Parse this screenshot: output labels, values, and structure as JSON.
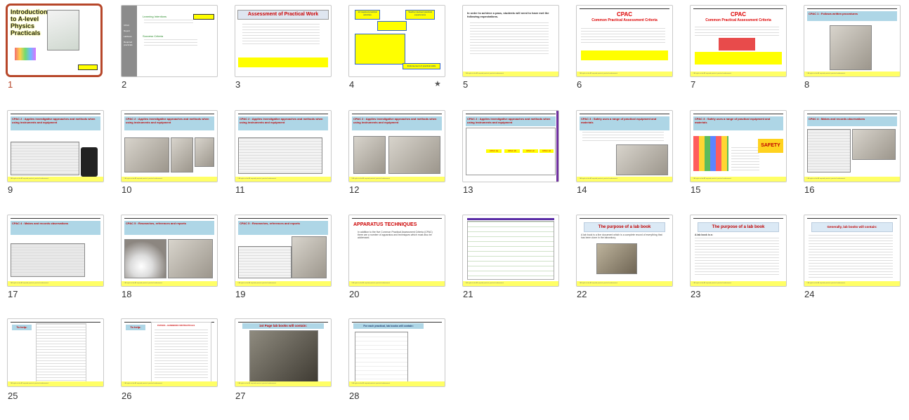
{
  "slides": [
    {
      "number": "1",
      "selected": true,
      "title": "Introduction to A-level Physics Practicals"
    },
    {
      "number": "2",
      "heading1": "Learning Intentions",
      "heading2": "Success Criteria",
      "side_items": [
        "CPAC",
        "Report",
        "Labbook",
        "Required practicals"
      ]
    },
    {
      "number": "3",
      "title": "Assessment of Practical Work"
    },
    {
      "number": "4",
      "star": "★",
      "box1": "12 required practical activities",
      "box2": "Teacher devised practical experiences",
      "bar": "Endorsement of practical skills"
    },
    {
      "number": "5",
      "title": "In order to achieve a pass, students will need to have met the following expectations."
    },
    {
      "number": "6",
      "title_big": "CPAC",
      "title_sub": "Common Practical Assessment Criteria"
    },
    {
      "number": "7",
      "title_big": "CPAC",
      "title_sub": "Common Practical Assessment Criteria"
    },
    {
      "number": "8",
      "header": "CPAC 1 : Follows written procedures"
    },
    {
      "number": "9",
      "header": "CPAC 2 : Applies investigative approaches and methods when using instruments and equipment"
    },
    {
      "number": "10",
      "header": "CPAC 2 : Applies investigative approaches and methods when using instruments and equipment"
    },
    {
      "number": "11",
      "header": "CPAC 2 : Applies investigative approaches and methods when using instruments and equipment"
    },
    {
      "number": "12",
      "header": "CPAC 2 : Applies investigative approaches and methods when using instruments and equipment"
    },
    {
      "number": "13",
      "header": "CPAC 2 : Applies investigative approaches and methods when using instruments and equipment",
      "cols": [
        "CPAC 2a",
        "CPAC 2b",
        "CPAC 2c",
        "CPAC 2d"
      ]
    },
    {
      "number": "14",
      "header": "CPAC 3 : Safely uses a range of practical equipment and materials"
    },
    {
      "number": "15",
      "header": "CPAC 3 : Safely uses a range of practical equipment and materials",
      "safety": "SAFETY"
    },
    {
      "number": "16",
      "header": "CPAC 4 : Makes and records observations"
    },
    {
      "number": "17",
      "header": "CPAC 4 : Makes and records observations"
    },
    {
      "number": "18",
      "header": "CPAC 5 : Researches, references and reports"
    },
    {
      "number": "19",
      "header": "CPAC 5 : Researches, references and reports"
    },
    {
      "number": "20",
      "title": "APPARATUS TECHNIQUES",
      "body": "In addition to the five Common Practical Assessment Criteria (CPAC) there are a number of apparatus and techniques which must also be addressed."
    },
    {
      "number": "21"
    },
    {
      "number": "22",
      "title": "The purpose of a lab book",
      "body": "A lab book is a live document which is a complete record of everything that has been done in the laboratory."
    },
    {
      "number": "23",
      "title": "The purpose of a lab book",
      "body": "A lab book is a:"
    },
    {
      "number": "24",
      "title": "Generally, lab books will contain:"
    },
    {
      "number": "25",
      "title": "To help:"
    },
    {
      "number": "26",
      "title": "To help:",
      "sub": "PHYSICS – HANDBOOK FOR PRACTICALS"
    },
    {
      "number": "27",
      "title": "1st Page lab books will contain:"
    },
    {
      "number": "28",
      "title": "For each practical, lab books will contain:"
    }
  ],
  "footer_text": "© All rights to the AS required practical, practical endorsement",
  "colors": {
    "accent": "#b7472a",
    "header_blue": "#aed6e6",
    "footer_yellow": "#ffff66",
    "title_red": "#cc0000"
  }
}
